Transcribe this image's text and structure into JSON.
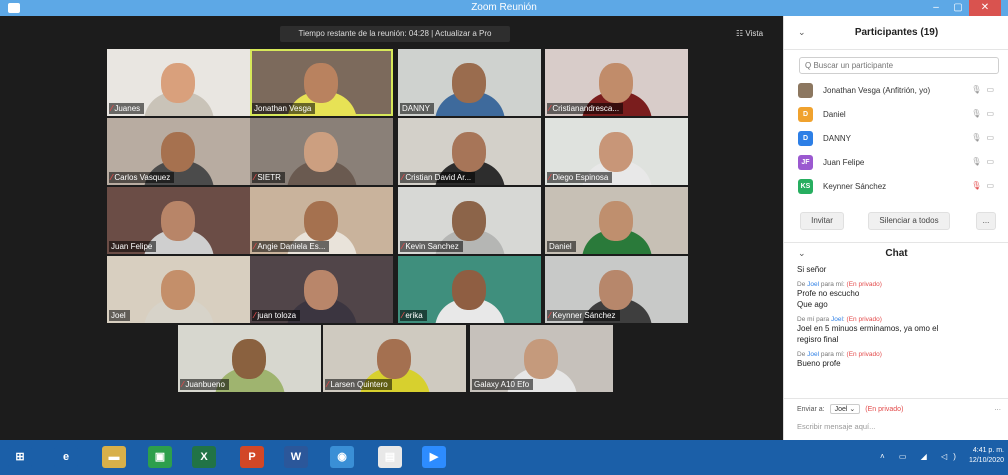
{
  "window": {
    "title": "Zoom Reunión",
    "minimize": "–",
    "maximize": "▢",
    "close": "✕"
  },
  "meeting": {
    "banner": "Tiempo restante de la reunión: 04:28 | Actualizar a Pro",
    "view_label": "☷ Vista",
    "muted_glyph": "⁄",
    "tiles": [
      {
        "name": "Juanes",
        "muted": true,
        "bg": "#e9e6e1",
        "shirt": "#c9c3b8",
        "skin": "#d9a07c",
        "active": false
      },
      {
        "name": "Jonathan Vesga",
        "muted": false,
        "bg": "#7c6a5c",
        "shirt": "#e7e255",
        "skin": "#b9825f",
        "active": true
      },
      {
        "name": "DANNY",
        "muted": false,
        "bg": "#cfd2cf",
        "shirt": "#3e6a9c",
        "skin": "#9a6c4e",
        "active": false
      },
      {
        "name": "Cristianandresca...",
        "muted": true,
        "bg": "#d8ccc9",
        "shirt": "#7a1d1d",
        "skin": "#c18c6a",
        "active": false
      },
      {
        "name": "Carlos Vasquez",
        "muted": true,
        "bg": "#b8aca1",
        "shirt": "#4b4b4b",
        "skin": "#a6714f",
        "active": false
      },
      {
        "name": "SIETR",
        "muted": true,
        "bg": "#8a8078",
        "shirt": "#6a5a50",
        "skin": "#cc9f80",
        "active": false
      },
      {
        "name": "Cristian David Ar...",
        "muted": true,
        "bg": "#d3d0c9",
        "shirt": "#2d2d2d",
        "skin": "#a77558",
        "active": false
      },
      {
        "name": "Diego Espinosa",
        "muted": true,
        "bg": "#dfe2de",
        "shirt": "#e8e8e8",
        "skin": "#c89678",
        "active": false
      },
      {
        "name": "Juan Felipe",
        "muted": false,
        "bg": "#6b4d46",
        "shirt": "#cfcfcf",
        "skin": "#b88568",
        "active": false
      },
      {
        "name": "Angie Daniela Es...",
        "muted": true,
        "bg": "#c9b39c",
        "shirt": "#e9e3da",
        "skin": "#a5714f",
        "active": false
      },
      {
        "name": "Kevin Sanchez",
        "muted": true,
        "bg": "#d7d8d5",
        "shirt": "#b5b6b4",
        "skin": "#8c6449",
        "active": false
      },
      {
        "name": "Daniel",
        "muted": false,
        "bg": "#c7c0b5",
        "shirt": "#2a7a3a",
        "skin": "#bf8f6e",
        "active": false
      },
      {
        "name": "Joel",
        "muted": false,
        "bg": "#d8cfc0",
        "shirt": "#d7d3c9",
        "skin": "#c48f6a",
        "active": false
      },
      {
        "name": "juan toloza",
        "muted": true,
        "bg": "#514549",
        "shirt": "#3b3540",
        "skin": "#b9866a",
        "active": false
      },
      {
        "name": "erika",
        "muted": true,
        "bg": "#3f8f7d",
        "shirt": "#e8e8e8",
        "skin": "#8f5e42",
        "active": false
      },
      {
        "name": "Keynner Sánchez",
        "muted": true,
        "bg": "#c8c9c8",
        "shirt": "#3e3e3e",
        "skin": "#b7876b",
        "active": false
      },
      {
        "name": "Juanbueno",
        "muted": true,
        "bg": "#d7d7cf",
        "shirt": "#9fb46f",
        "skin": "#8a613f",
        "active": false
      },
      {
        "name": "Larsen Quintero",
        "muted": true,
        "bg": "#cfcac0",
        "shirt": "#d7d02e",
        "skin": "#a47050",
        "active": false
      },
      {
        "name": "Galaxy A10 Efo",
        "muted": false,
        "bg": "#c6c1bb",
        "shirt": "#e6e6e6",
        "skin": "#c59a7c",
        "active": false
      }
    ]
  },
  "participants": {
    "title": "Participantes (19)",
    "collapse_glyph": "⌄",
    "search_placeholder": "Q Buscar un participante",
    "icons_on": "🎙 ▭",
    "icons_muted": "🎙 ▭",
    "list": [
      {
        "name": "Jonathan Vesga (Anfitrión, yo)",
        "initials": "",
        "color": "#8c7760",
        "muted": false
      },
      {
        "name": "Daniel",
        "initials": "D",
        "color": "#f0a22e",
        "muted": false
      },
      {
        "name": "DANNY",
        "initials": "D",
        "color": "#2d7fe6",
        "muted": false
      },
      {
        "name": "Juan Felipe",
        "initials": "JF",
        "color": "#9b59d0",
        "muted": false
      },
      {
        "name": "Keynner Sánchez",
        "initials": "KS",
        "color": "#27ae60",
        "muted": true
      }
    ],
    "invite": "Invitar",
    "mute_all": "Silenciar a todos",
    "more": "..."
  },
  "chat": {
    "title": "Chat",
    "collapse_glyph": "⌄",
    "messages": [
      {
        "meta_from": "",
        "meta_mid": "",
        "meta_to": "",
        "meta_priv": "",
        "lines": [
          "Si señor"
        ]
      },
      {
        "meta_from": "De ",
        "meta_mid": "Joel",
        "meta_to": " para mí: ",
        "meta_priv": "(En privado)",
        "lines": [
          "Profe no escucho",
          "Que ago"
        ]
      },
      {
        "meta_from": "De mí para ",
        "meta_mid": "Joel",
        "meta_to": ": ",
        "meta_priv": "(En privado)",
        "lines": [
          "Joel en 5 minuos erminamos, ya omo el",
          "regisro final"
        ]
      },
      {
        "meta_from": "De ",
        "meta_mid": "Joel",
        "meta_to": " para mí: ",
        "meta_priv": "(En privado)",
        "lines": [
          "Bueno profe"
        ]
      }
    ],
    "send_to_label": "Enviar a:",
    "send_to_value": "Joel ⌄",
    "send_private": "(En privado)",
    "compose_more": "...",
    "compose_placeholder": "Escribir mensaje aquí..."
  },
  "taskbar": {
    "icons": [
      {
        "name": "start-icon",
        "glyph": "⊞",
        "color": "#1b5fa8"
      },
      {
        "name": "ie-icon",
        "glyph": "e",
        "color": "#1b5fa8"
      },
      {
        "name": "file-explorer-icon",
        "glyph": "▬",
        "color": "#d8b04a"
      },
      {
        "name": "store-icon",
        "glyph": "▣",
        "color": "#2d9f4c"
      },
      {
        "name": "excel-icon",
        "glyph": "X",
        "color": "#217346"
      },
      {
        "name": "powerpoint-icon",
        "glyph": "P",
        "color": "#d24726"
      },
      {
        "name": "word-icon",
        "glyph": "W",
        "color": "#2b579a"
      },
      {
        "name": "chrome-icon",
        "glyph": "◉",
        "color": "#3a8fd6"
      },
      {
        "name": "files-icon",
        "glyph": "▤",
        "color": "#e8e8e8"
      },
      {
        "name": "zoom-icon",
        "glyph": "▶",
        "color": "#2d8cff"
      }
    ],
    "tray": "˄ ▭ ◢ ◁)",
    "time": "4:41 p. m.",
    "date": "12/10/2020"
  }
}
